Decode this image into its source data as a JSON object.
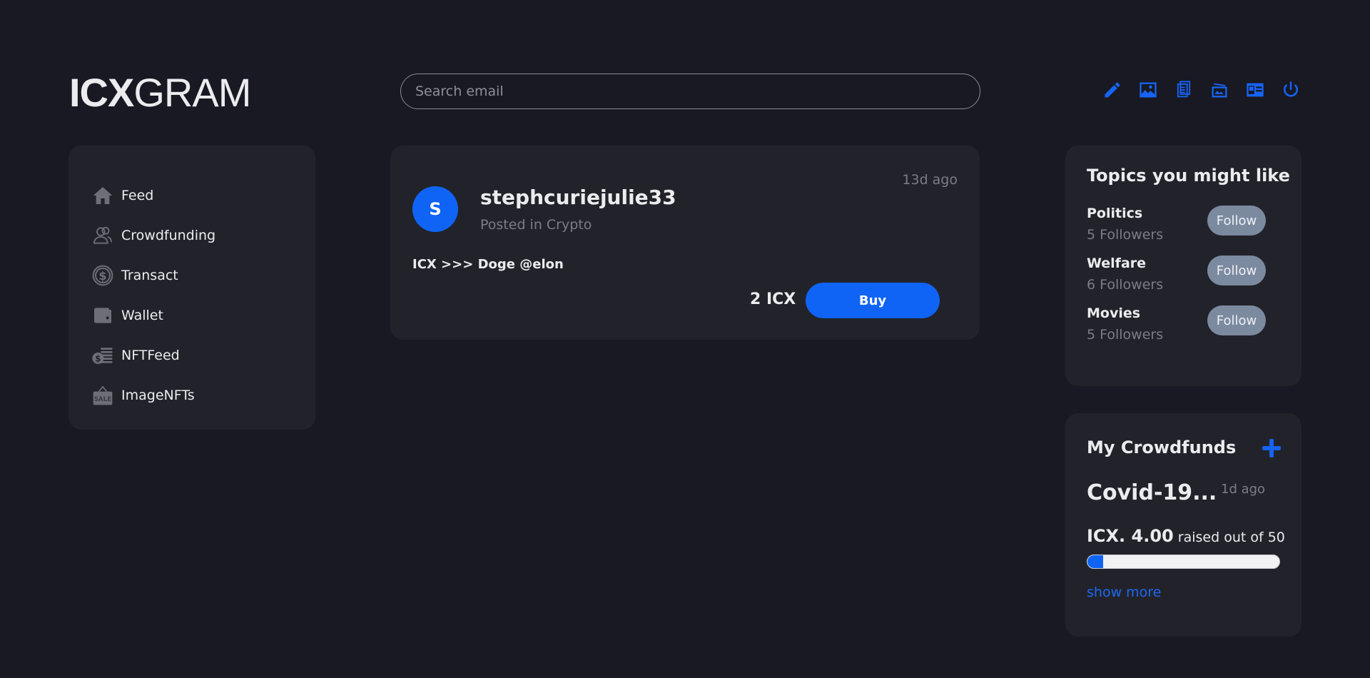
{
  "header": {
    "logo_bold": "ICX",
    "logo_light": "GRAM",
    "search_placeholder": "Search email",
    "icons": [
      "edit-icon",
      "image-icon",
      "documents-icon",
      "photo-album-icon",
      "id-card-icon",
      "power-icon"
    ]
  },
  "colors": {
    "background": "#181922",
    "card": "#22232a",
    "accent": "#0f64f5",
    "muted_text": "#7b7c85",
    "follow_button": "#7c8aa0"
  },
  "sidebar": {
    "items": [
      {
        "label": "Feed",
        "icon": "home-icon"
      },
      {
        "label": "Crowdfunding",
        "icon": "people-icon"
      },
      {
        "label": "Transact",
        "icon": "dollar-coin-icon"
      },
      {
        "label": "Wallet",
        "icon": "wallet-icon"
      },
      {
        "label": "NFTFeed",
        "icon": "coins-stack-icon"
      },
      {
        "label": "ImageNFTs",
        "icon": "sale-sign-icon"
      }
    ]
  },
  "post": {
    "avatar_letter": "S",
    "username": "stephcuriejulie33",
    "category": "Posted in Crypto",
    "time": "13d ago",
    "body": "ICX >>> Doge @elon",
    "price": "2 ICX",
    "buy_label": "Buy"
  },
  "topics": {
    "title": "Topics you might like",
    "items": [
      {
        "name": "Politics",
        "followers": "5 Followers",
        "button": "Follow"
      },
      {
        "name": "Welfare",
        "followers": "6 Followers",
        "button": "Follow"
      },
      {
        "name": "Movies",
        "followers": "5 Followers",
        "button": "Follow"
      }
    ]
  },
  "crowdfunds": {
    "title": "My Crowdfunds",
    "name": "Covid-19...",
    "time": "1d ago",
    "amount": "ICX. 4.00",
    "raised_text": " raised out of 50",
    "progress_fraction": 0.08,
    "show_more": "show more"
  }
}
